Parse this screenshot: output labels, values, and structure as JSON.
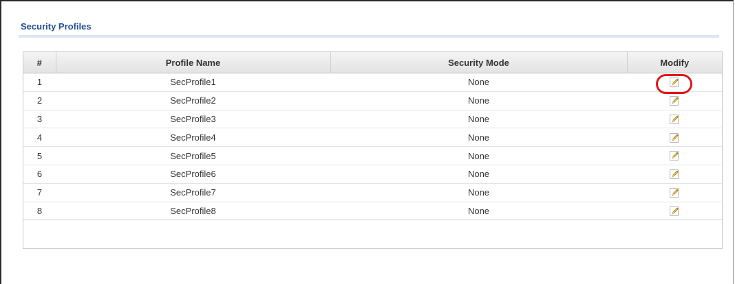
{
  "section": {
    "title": "Security Profiles"
  },
  "table": {
    "columns": [
      "#",
      "Profile Name",
      "Security Mode",
      "Modify"
    ],
    "rows": [
      {
        "index": "1",
        "name": "SecProfile1",
        "mode": "None"
      },
      {
        "index": "2",
        "name": "SecProfile2",
        "mode": "None"
      },
      {
        "index": "3",
        "name": "SecProfile3",
        "mode": "None"
      },
      {
        "index": "4",
        "name": "SecProfile4",
        "mode": "None"
      },
      {
        "index": "5",
        "name": "SecProfile5",
        "mode": "None"
      },
      {
        "index": "6",
        "name": "SecProfile6",
        "mode": "None"
      },
      {
        "index": "7",
        "name": "SecProfile7",
        "mode": "None"
      },
      {
        "index": "8",
        "name": "SecProfile8",
        "mode": "None"
      }
    ],
    "modify_icon": "edit-pencil-icon"
  },
  "colors": {
    "title": "#1f4e93",
    "highlight": "#e0161b"
  }
}
